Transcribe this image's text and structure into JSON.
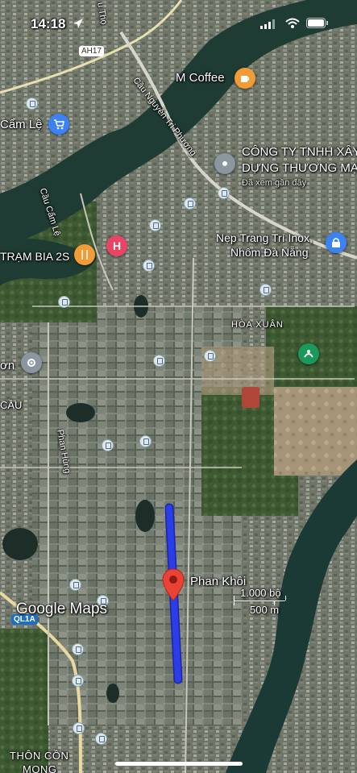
{
  "status_bar": {
    "time": "14:18"
  },
  "labels": {
    "m_coffee": "M Coffee",
    "cam_le": "Cẩm Lệ",
    "cau_nguyen_tri_phuong": "Cầu Nguyễn Tri Phương",
    "cong_ty_line1": "CÔNG TY TNHH XÂY",
    "cong_ty_line2": "DỰNG THƯƠNG MẠ",
    "cong_ty_sub": "Đã xem gần đây",
    "nep_trang_line1": "Nẹp Trang Trí Inox,",
    "nep_trang_line2": "Nhôm Đà Nẵng",
    "cau_cam_le": "Cầu Cẩm Lệ",
    "tram_bia": "TRẠM BIA 2S",
    "hoa_xuan": "HÒA XUÂN",
    "on": "ơn",
    "cau": "CẦU",
    "phan_hung": "Phan Hùng",
    "phan_khoi": "Phan Khôi",
    "road_ah17": "AH17",
    "road_ql1a": "QL1A",
    "thon_con_line1": "THÔN CỒN",
    "thon_con_line2": "MONG",
    "road_u_tho": "u Thọ"
  },
  "scale": {
    "imperial": "1.000 bộ",
    "metric": "500 m"
  },
  "brand": {
    "google_maps": "Google Maps"
  },
  "colors": {
    "route": "#2b3de8",
    "pin": "#ea4335",
    "coffee": "#f29c38",
    "hotel": "#e94466",
    "shop_blue": "#3b82f6",
    "food": "#f29c38",
    "leisure": "#1a9a5a",
    "gray_poi": "#8a96a0"
  },
  "icons": [
    "location-arrow-icon",
    "signal-icon",
    "wifi-icon",
    "battery-icon",
    "coffee-icon",
    "shopping-cart-icon",
    "place-pin-icon",
    "lock-bag-icon",
    "fork-knife-icon",
    "hotel-icon",
    "bus-stop-icon",
    "gear-icon",
    "recreation-icon",
    "map-pin-icon"
  ]
}
